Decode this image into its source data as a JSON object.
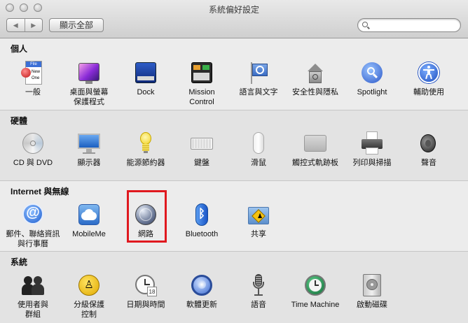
{
  "window": {
    "title": "系統偏好設定"
  },
  "toolbar": {
    "back": "◀",
    "forward": "▶",
    "show_all": "顯示全部",
    "search_placeholder": ""
  },
  "sections": [
    {
      "title": "個人",
      "items": [
        {
          "label": "一般",
          "icon": "general-icon"
        },
        {
          "label": "桌面與螢幕\n保護程式",
          "icon": "desktop-screensaver-icon"
        },
        {
          "label": "Dock",
          "icon": "dock-icon"
        },
        {
          "label": "Mission\nControl",
          "icon": "mission-control-icon"
        },
        {
          "label": "語言與文字",
          "icon": "language-text-icon"
        },
        {
          "label": "安全性與隱私",
          "icon": "security-privacy-icon"
        },
        {
          "label": "Spotlight",
          "icon": "spotlight-icon"
        },
        {
          "label": "輔助使用",
          "icon": "accessibility-icon"
        }
      ]
    },
    {
      "title": "硬體",
      "items": [
        {
          "label": "CD 與 DVD",
          "icon": "cd-dvd-icon"
        },
        {
          "label": "顯示器",
          "icon": "displays-icon"
        },
        {
          "label": "能源節約器",
          "icon": "energy-saver-icon"
        },
        {
          "label": "鍵盤",
          "icon": "keyboard-icon"
        },
        {
          "label": "滑鼠",
          "icon": "mouse-icon"
        },
        {
          "label": "觸控式軌跡板",
          "icon": "trackpad-icon"
        },
        {
          "label": "列印與掃描",
          "icon": "print-scan-icon"
        },
        {
          "label": "聲音",
          "icon": "sound-icon"
        }
      ]
    },
    {
      "title": "Internet 與無線",
      "items": [
        {
          "label": "郵件、聯絡資訊\n與行事曆",
          "icon": "mail-contacts-calendars-icon"
        },
        {
          "label": "MobileMe",
          "icon": "mobileme-icon"
        },
        {
          "label": "網路",
          "icon": "network-icon"
        },
        {
          "label": "Bluetooth",
          "icon": "bluetooth-icon"
        },
        {
          "label": "共享",
          "icon": "sharing-icon"
        }
      ]
    },
    {
      "title": "系統",
      "items": [
        {
          "label": "使用者與\n群組",
          "icon": "users-groups-icon"
        },
        {
          "label": "分級保護\n控制",
          "icon": "parental-controls-icon"
        },
        {
          "label": "日期與時間",
          "icon": "date-time-icon"
        },
        {
          "label": "軟體更新",
          "icon": "software-update-icon"
        },
        {
          "label": "語音",
          "icon": "speech-icon"
        },
        {
          "label": "Time Machine",
          "icon": "time-machine-icon"
        },
        {
          "label": "啟動磁碟",
          "icon": "startup-disk-icon"
        }
      ]
    }
  ],
  "highlight": {
    "item": "網路",
    "color": "#e0191f"
  },
  "icon_text": {
    "general_file": "File",
    "general_new": "New",
    "general_open": "One",
    "date_day": "18"
  }
}
